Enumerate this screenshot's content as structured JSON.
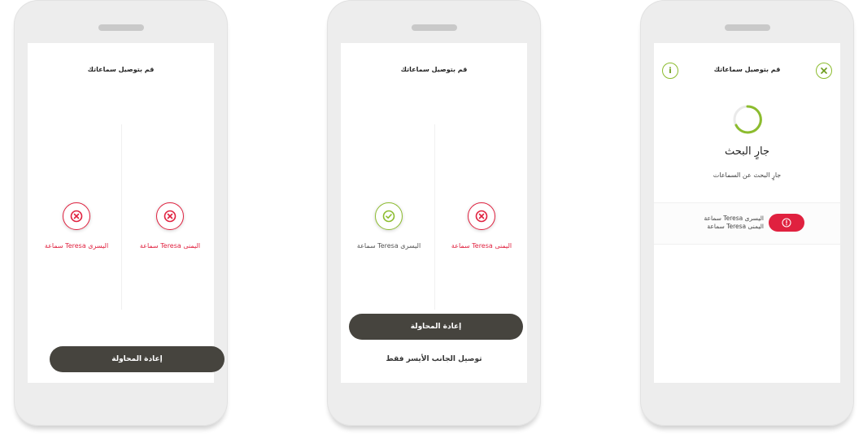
{
  "colors": {
    "error": "#e0213f",
    "success": "#8cbc2e",
    "button": "#46443e"
  },
  "phone1": {
    "title": "قم بتوصيل سماعاتك",
    "right_aid": {
      "label": "سماعة Teresa اليمنى",
      "status": "error",
      "icon": "x-icon"
    },
    "left_aid": {
      "label": "سماعة Teresa اليسرى",
      "status": "error",
      "icon": "x-icon"
    },
    "retry_button": "إعادة المحاولة"
  },
  "phone2": {
    "title": "قم بتوصيل سماعاتك",
    "right_aid": {
      "label": "سماعة Teresa اليمنى",
      "status": "error",
      "icon": "x-icon"
    },
    "left_aid": {
      "label": "سماعة Teresa اليسرى",
      "status": "connected",
      "icon": "check-icon"
    },
    "retry_button": "إعادة المحاولة",
    "left_only_link": "توصيل الجانب الأيسر فقط"
  },
  "phone3": {
    "title": "قم بتوصيل سماعاتك",
    "info_icon": "info-icon",
    "close_icon": "close-icon",
    "searching_title": "جارٍ البحث",
    "searching_subtitle": "جارٍ البحث عن السماعات",
    "device_left": "سماعة Teresa اليسرى",
    "device_right": "سماعة Teresa اليمنى",
    "device_action_icon": "info-icon"
  }
}
